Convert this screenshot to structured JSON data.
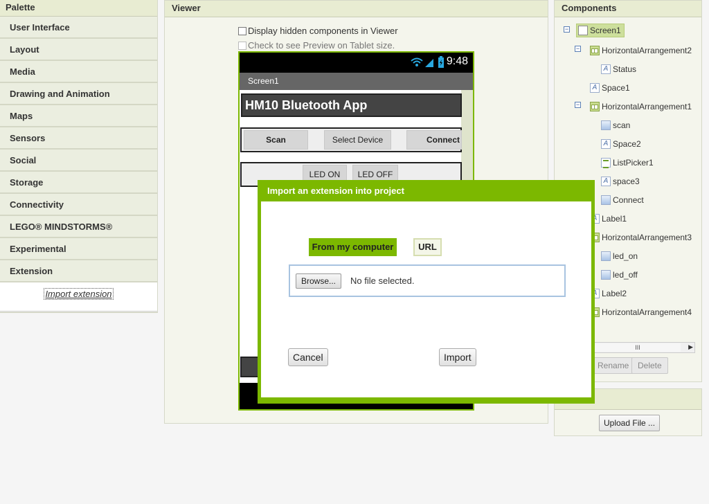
{
  "palette": {
    "title": "Palette",
    "items": [
      {
        "label": "User Interface"
      },
      {
        "label": "Layout"
      },
      {
        "label": "Media"
      },
      {
        "label": "Drawing and Animation"
      },
      {
        "label": "Maps"
      },
      {
        "label": "Sensors"
      },
      {
        "label": "Social"
      },
      {
        "label": "Storage"
      },
      {
        "label": "Connectivity"
      },
      {
        "label": "LEGO® MINDSTORMS®"
      },
      {
        "label": "Experimental"
      },
      {
        "label": "Extension"
      }
    ],
    "import_extension_link": "Import extension"
  },
  "viewer": {
    "title": "Viewer",
    "checkbox_hidden": "Display hidden components in Viewer",
    "checkbox_tablet": "Check to see Preview on Tablet size.",
    "phone": {
      "time": "9:48",
      "screen_title": "Screen1",
      "app_title": "HM10 Bluetooth App",
      "buttons": {
        "scan": "Scan",
        "select_device": "Select Device",
        "connect": "Connect",
        "led_on": "LED ON",
        "led_off": "LED OFF"
      }
    }
  },
  "components": {
    "title": "Components",
    "tree": [
      {
        "label": "Screen1",
        "icon": "screen-icon"
      },
      {
        "label": "HorizontalArrangement2",
        "icon": "horizontal-arrangement-icon"
      },
      {
        "label": "Status",
        "icon": "label-icon"
      },
      {
        "label": "Space1",
        "icon": "label-icon"
      },
      {
        "label": "HorizontalArrangement1",
        "icon": "horizontal-arrangement-icon"
      },
      {
        "label": "scan",
        "icon": "button-icon"
      },
      {
        "label": "Space2",
        "icon": "label-icon"
      },
      {
        "label": "ListPicker1",
        "icon": "listpicker-icon"
      },
      {
        "label": "space3",
        "icon": "label-icon"
      },
      {
        "label": "Connect",
        "icon": "button-icon"
      },
      {
        "label": "Label1",
        "icon": "label-icon"
      },
      {
        "label": "HorizontalArrangement3",
        "icon": "horizontal-arrangement-icon"
      },
      {
        "label": "led_on",
        "icon": "button-icon"
      },
      {
        "label": "led_off",
        "icon": "button-icon"
      },
      {
        "label": "Label2",
        "icon": "label-icon"
      },
      {
        "label": "HorizontalArrangement4",
        "icon": "horizontal-arrangement-icon"
      }
    ],
    "scroll_thumb": "III",
    "rename_label": "Rename",
    "delete_label": "Delete"
  },
  "media": {
    "upload_label": "Upload File ..."
  },
  "dialog": {
    "title": "Import an extension into project",
    "tab_computer": "From my computer",
    "tab_url": "URL",
    "browse_label": "Browse...",
    "no_file": "No file selected.",
    "cancel_label": "Cancel",
    "import_label": "Import"
  },
  "colors": {
    "accent_green": "#7cb800",
    "selected_green": "#cddf9c"
  }
}
